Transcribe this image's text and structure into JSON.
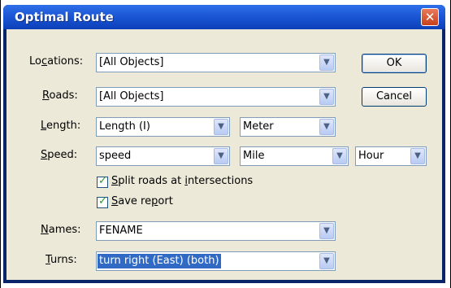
{
  "window": {
    "title": "Optimal Route",
    "close_glyph": "✕"
  },
  "fields": {
    "locations": {
      "label_pre": "Lo",
      "label_mnemonic": "c",
      "label_post": "ations:",
      "value": "[All Objects]"
    },
    "roads": {
      "label_pre": "",
      "label_mnemonic": "R",
      "label_post": "oads:",
      "value": "[All Objects]"
    },
    "length": {
      "label_pre": "",
      "label_mnemonic": "L",
      "label_post": "ength:",
      "value": "Length (I)",
      "unit": "Meter"
    },
    "speed": {
      "label_pre": "",
      "label_mnemonic": "S",
      "label_post": "peed:",
      "value": "speed",
      "unit": "Mile",
      "time_unit": "Hour"
    },
    "names": {
      "label_pre": "",
      "label_mnemonic": "N",
      "label_post": "ames:",
      "value": "FENAME"
    },
    "turns": {
      "label_pre": "",
      "label_mnemonic": "T",
      "label_post": "urns:",
      "value": "turn right (East) (both)"
    }
  },
  "checkboxes": {
    "split": {
      "label_pre": "",
      "label_mnemonic": "S",
      "label_post": "plit roads at ",
      "label_mn2": "i",
      "label_post2": "ntersections",
      "checked": true
    },
    "report": {
      "label_pre": "",
      "label_mnemonic": "S",
      "label_post": "ave re",
      "label_mn2": "p",
      "label_post2": "ort",
      "checked": true
    }
  },
  "buttons": {
    "ok": "OK",
    "cancel": "Cancel"
  },
  "icons": {
    "dropdown": "chevron-down-icon",
    "check": "checkmark-icon"
  },
  "colors": {
    "titlebar": "#1c57d6",
    "dialog_bg": "#ece9d8",
    "selection": "#316ac5",
    "check": "#21a121"
  }
}
